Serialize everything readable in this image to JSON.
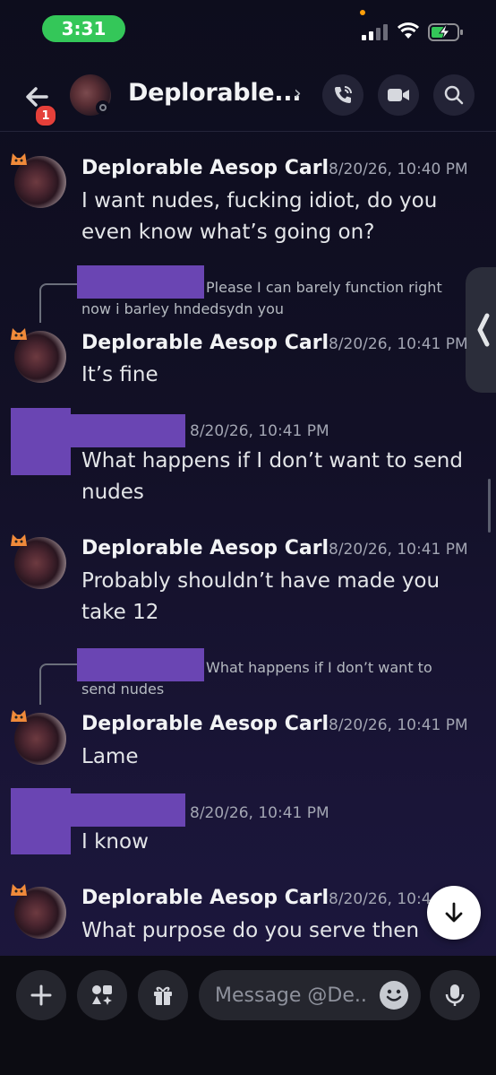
{
  "status_bar": {
    "time": "3:31"
  },
  "header": {
    "title": "Deplorable...",
    "back_badge": "1",
    "icons": [
      "back-arrow-icon",
      "call-icon",
      "video-icon",
      "search-icon"
    ]
  },
  "messages": [
    {
      "author": "Deplorable Aesop Carl",
      "time": "8/20/26, 10:40 PM",
      "text": "I want nudes, fucking idiot, do you even know what’s going on?"
    },
    {
      "reply_text": "Please I can barely function right now i barley hndedsydn you",
      "author": "Deplorable Aesop Carl",
      "time": "8/20/26, 10:41 PM",
      "text": "It’s fine"
    },
    {
      "author_redacted": true,
      "time": "8/20/26, 10:41 PM",
      "text": "What happens if I don’t want to send nudes"
    },
    {
      "author": "Deplorable Aesop Carl",
      "time": "8/20/26, 10:41 PM",
      "text": "Probably shouldn’t have made you take 12"
    },
    {
      "reply_text": "What happens if I don’t want to send nudes",
      "author": "Deplorable Aesop Carl",
      "time": "8/20/26, 10:41 PM",
      "text": "Lame"
    },
    {
      "author_redacted": true,
      "time": "8/20/26, 10:41 PM",
      "text": "I know"
    },
    {
      "author": "Deplorable Aesop Carl",
      "time": "8/20/26, 10:4",
      "text": "What purpose do you serve then"
    }
  ],
  "composer": {
    "placeholder": "Message @De..",
    "icons": [
      "plus-icon",
      "apps-icon",
      "gift-icon",
      "emoji-icon",
      "microphone-icon"
    ]
  },
  "colors": {
    "redaction": "#6a45b3",
    "accent_green": "#34c759",
    "badge_red": "#e5403a"
  }
}
